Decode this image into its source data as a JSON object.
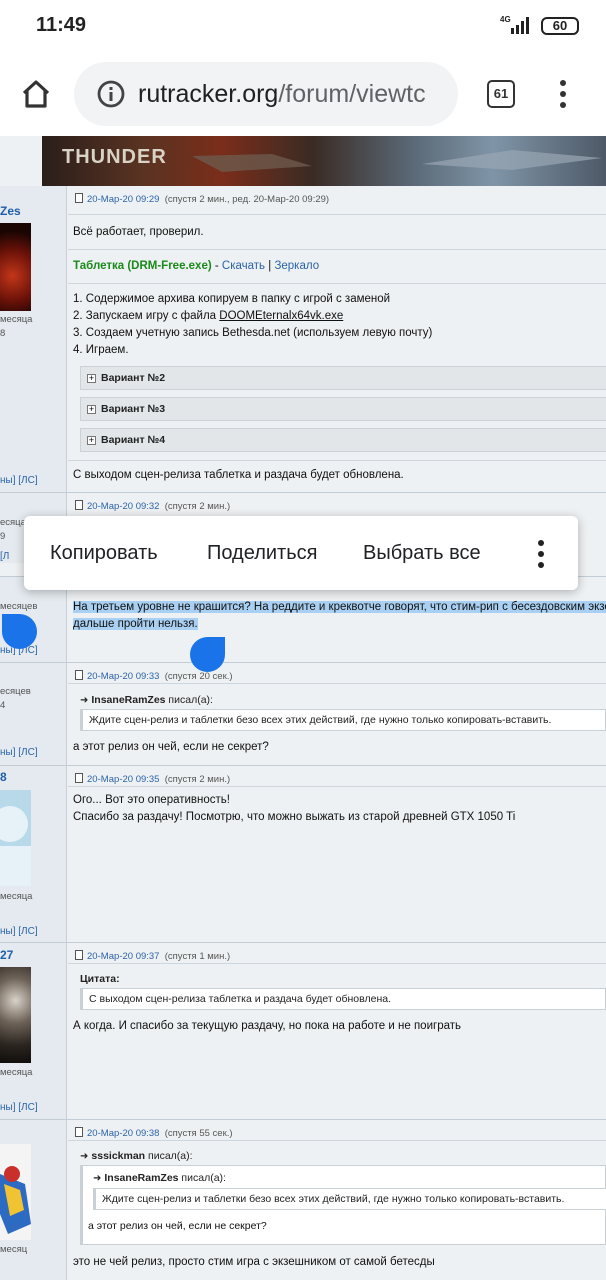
{
  "status_bar": {
    "time": "11:49",
    "network": "4G",
    "battery": "60"
  },
  "browser": {
    "url_domain": "rutracker.org",
    "url_path": "/forum/viewtc",
    "tab_count": "61"
  },
  "banner": {
    "title": "THUNDER"
  },
  "context_menu": {
    "copy": "Копировать",
    "share": "Поделиться",
    "select_all": "Выбрать все"
  },
  "posts": [
    {
      "user": {
        "name": "Zes",
        "meta1": "месяца",
        "meta2": "8",
        "links": "ны] [ЛС]"
      },
      "date": "20-Мар-20 09:29",
      "after": "(спустя 2 мин., ред. 20-Мар-20 09:29)",
      "line1": "Всё работает, проверил.",
      "drm_label": "Таблетка (DRM-Free.exe)",
      "drm_sep1": " - ",
      "drm_download": "Скачать",
      "drm_sep2": " | ",
      "drm_mirror": "Зеркало",
      "steps": [
        "1. Содержимое архива копируем в папку с игрой с заменой",
        "2. Запускаем игру с файла ",
        "3. Создаем учетную запись Bethesda.net (используем левую почту)",
        "4. Играем."
      ],
      "exe_name": "DOOMEternalx64vk.exe",
      "spoilers": [
        "Вариант №2",
        "Вариант №3",
        "Вариант №4"
      ],
      "footer": "С выходом сцен-релиза таблетка и раздача будет обновлена."
    },
    {
      "user": {
        "meta1": "есяца",
        "meta2": "9",
        "links": "[Л"
      },
      "date": "20-Мар-20 09:32",
      "after": "(спустя 2 мин.)"
    },
    {
      "user": {
        "meta1": "месяцев",
        "links": "ны] [ЛС]"
      },
      "line1": "На третьем уровне не крашится? На реддите и креквотче говорят, что стим-рип с бесездовским экзе",
      "line2": "дальше пройти нельзя."
    },
    {
      "user": {
        "meta1": "есяцев",
        "meta2": "4",
        "links": "ны] [ЛС]"
      },
      "date": "20-Мар-20 09:33",
      "after": "(спустя 20 сек.)",
      "quote_author": "InsaneRamZes",
      "quote_wrote": " писал(а):",
      "quote_text": "Ждите сцен-релиз и таблетки безо всех этих действий, где нужно только копировать-вставить.",
      "text": "а этот релиз он чей, если не секрет?"
    },
    {
      "user": {
        "name": "8",
        "meta1": "месяца",
        "links": "ны] [ЛС]"
      },
      "date": "20-Мар-20 09:35",
      "after": "(спустя 2 мин.)",
      "line1": "Ого... Вот это оперативность!",
      "line2": "Спасибо за раздачу! Посмотрю, что можно выжать из старой древней GTX 1050 Ti"
    },
    {
      "user": {
        "name": "27",
        "meta1": "месяца",
        "links": "ны] [ЛС]"
      },
      "date": "20-Мар-20 09:37",
      "after": "(спустя 1 мин.)",
      "quote_label": "Цитата:",
      "quote_text": "С выходом сцен-релиза таблетка и раздача будет обновлена.",
      "text": "А когда. И спасибо за текущую раздачу, но пока на работе и не поиграть"
    },
    {
      "user": {
        "meta1": "месяц"
      },
      "date": "20-Мар-20 09:38",
      "after": "(спустя 55 сек.)",
      "quote_author": "sssickman",
      "quote_wrote": " писал(а):",
      "inner_quote_author": "InsaneRamZes",
      "inner_quote_text": "Ждите сцен-релиз и таблетки безо всех этих действий, где нужно только копировать-вставить.",
      "quote_text": "а этот релиз он чей, если не секрет?",
      "text": "это не чей релиз, просто стим игра с экзешником от самой бетесды"
    }
  ]
}
